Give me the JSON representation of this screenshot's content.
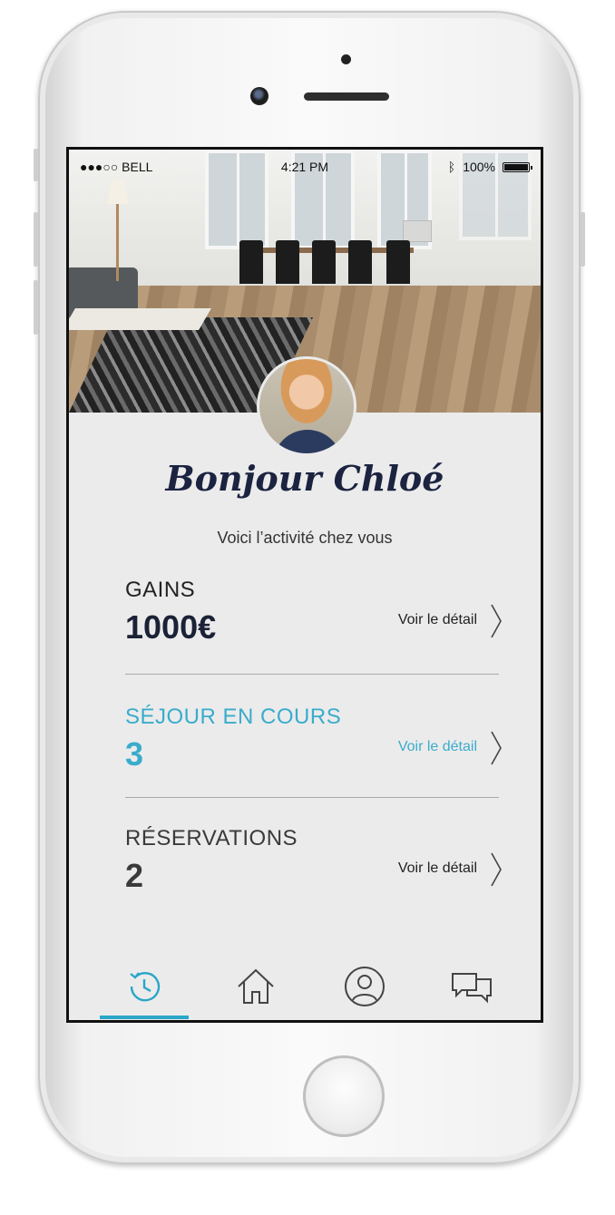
{
  "status_bar": {
    "carrier": "●●●○○ BELL",
    "time": "4:21 PM",
    "battery": "100%"
  },
  "profile": {
    "greeting": "Bonjour Chloé",
    "subtitle": "Voici l’activité chez vous"
  },
  "stats": [
    {
      "label": "GAINS",
      "value": "1000€",
      "link": "Voir le détail"
    },
    {
      "label": "SÉJOUR EN COURS",
      "value": "3",
      "link": "Voir le détail"
    },
    {
      "label": "RÉSERVATIONS",
      "value": "2",
      "link": "Voir le détail"
    }
  ],
  "tabbar": {
    "tabs": [
      {
        "icon": "history-icon",
        "active": true
      },
      {
        "icon": "home-icon",
        "active": false
      },
      {
        "icon": "profile-icon",
        "active": false
      },
      {
        "icon": "chat-icon",
        "active": false
      }
    ]
  },
  "colors": {
    "accent": "#2aa6c7",
    "dark_text": "#1b2236",
    "screen_bg": "#ebebec"
  }
}
